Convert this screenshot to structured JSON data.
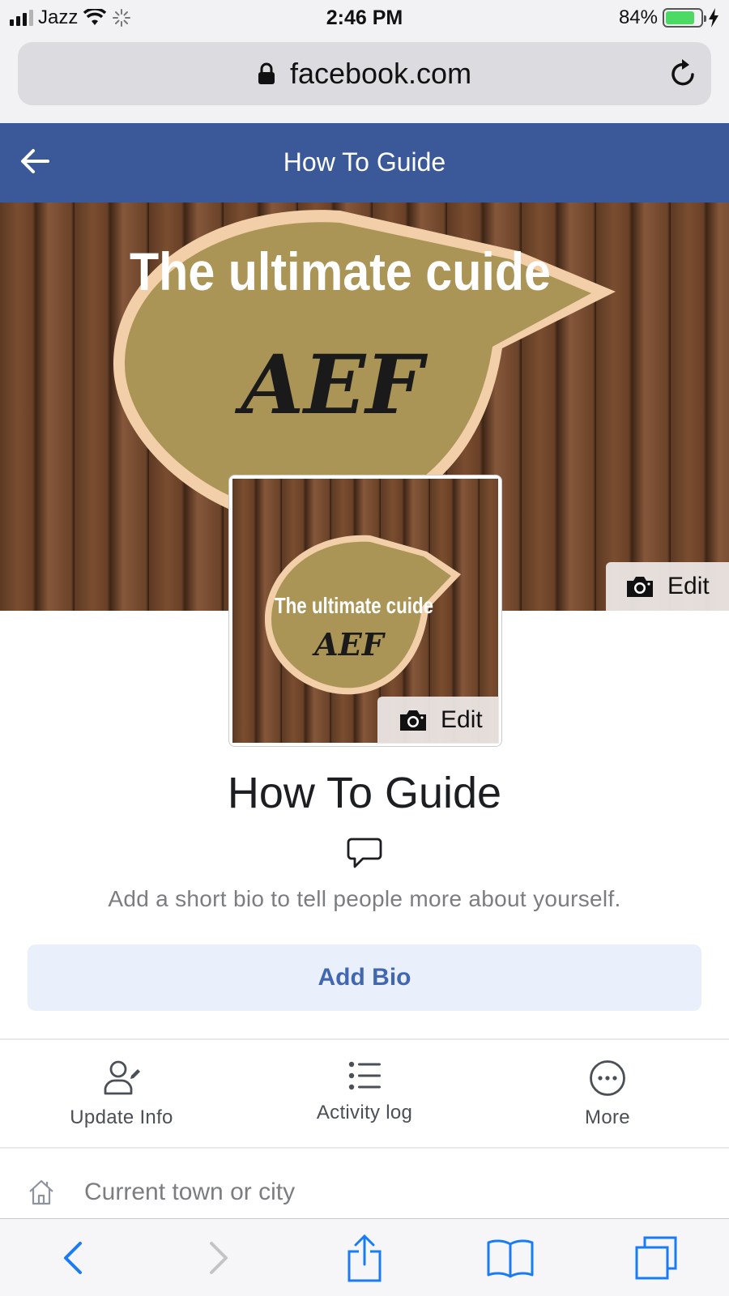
{
  "status_bar": {
    "carrier": "Jazz",
    "time": "2:46 PM",
    "battery_percent_text": "84%",
    "battery_level": 0.84,
    "battery_color": "#4cd964"
  },
  "browser": {
    "url": "facebook.com",
    "icons": [
      "lock-icon",
      "reload-icon"
    ]
  },
  "header": {
    "title": "How To Guide",
    "color": "#3b5998",
    "icons": [
      "back-arrow-icon"
    ]
  },
  "cover": {
    "logo_line1": "The ultimate cuide",
    "logo_line2": "AEF",
    "edit_label": "Edit"
  },
  "profile": {
    "picture_line1": "The ultimate cuide",
    "picture_line2": "AEF",
    "edit_label": "Edit",
    "name": "How To Guide"
  },
  "bio": {
    "prompt": "Add a short bio to tell people more about yourself.",
    "button_label": "Add Bio",
    "accent_color": "#4267b2"
  },
  "actions": [
    {
      "label": "Update Info",
      "icon": "person-edit-icon"
    },
    {
      "label": "Activity log",
      "icon": "list-icon"
    },
    {
      "label": "More",
      "icon": "more-circle-icon"
    }
  ],
  "details": {
    "town_placeholder": "Current town or city",
    "town_icon": "home-icon"
  },
  "toolbar": {
    "icons": [
      "back-icon",
      "forward-icon",
      "share-icon",
      "bookmarks-icon",
      "tabs-icon"
    ],
    "active_color": "#1a7cf5"
  }
}
